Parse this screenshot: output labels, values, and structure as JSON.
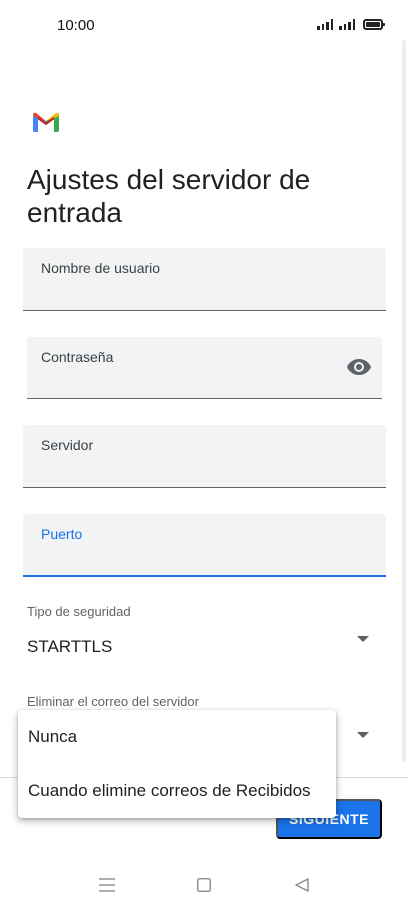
{
  "status_bar": {
    "time": "10:00",
    "icons": [
      "signal-icon",
      "signal-icon",
      "battery-icon"
    ]
  },
  "app": {
    "logo": "gmail-logo",
    "title": "Ajustes del servidor de entrada"
  },
  "form": {
    "username": {
      "label": "Nombre de usuario",
      "value": ""
    },
    "password": {
      "label": "Contraseña",
      "value": "",
      "toggle_icon": "eye-icon"
    },
    "server": {
      "label": "Servidor",
      "value": ""
    },
    "port": {
      "label": "Puerto",
      "value": "",
      "focused": true
    },
    "security_type": {
      "label": "Tipo de seguridad",
      "value": "STARTTLS"
    },
    "delete_from_server": {
      "label": "Eliminar el correo del servidor"
    }
  },
  "dropdown_menu": {
    "options": [
      "Nunca",
      "Cuando elimine correos de Recibidos"
    ]
  },
  "footer": {
    "next_label": "SIGUIENTE"
  },
  "colors": {
    "accent": "#1a73e8",
    "field_bg": "#f1f3f4",
    "text": "#202124"
  },
  "nav_bar": {
    "icons": [
      "menu-icon",
      "home-icon",
      "back-icon"
    ]
  }
}
